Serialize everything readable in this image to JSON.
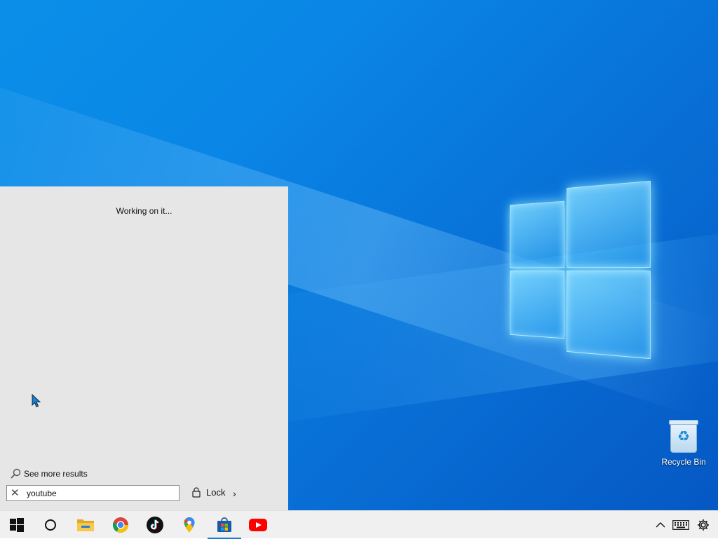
{
  "desktop": {
    "recycle_bin_label": "Recycle Bin"
  },
  "start_panel": {
    "status_text": "Working on it...",
    "see_more_label": "See more results",
    "search_value": "youtube",
    "lock_label": "Lock"
  },
  "taskbar": {
    "items": [
      {
        "icon": "windows-start-icon"
      },
      {
        "icon": "cortana-circle-icon"
      },
      {
        "icon": "file-explorer-icon"
      },
      {
        "icon": "chrome-icon"
      },
      {
        "icon": "tiktok-icon"
      },
      {
        "icon": "google-maps-icon"
      },
      {
        "icon": "microsoft-store-icon",
        "active": true
      },
      {
        "icon": "youtube-icon"
      }
    ],
    "tray": [
      "chevron-up-icon",
      "keyboard-icon",
      "settings-gear-icon"
    ]
  },
  "colors": {
    "accent": "#1a7ad4",
    "panel_bg": "#e6e6e6",
    "taskbar_bg": "#f0f0f0",
    "youtube_red": "#ff0000"
  }
}
